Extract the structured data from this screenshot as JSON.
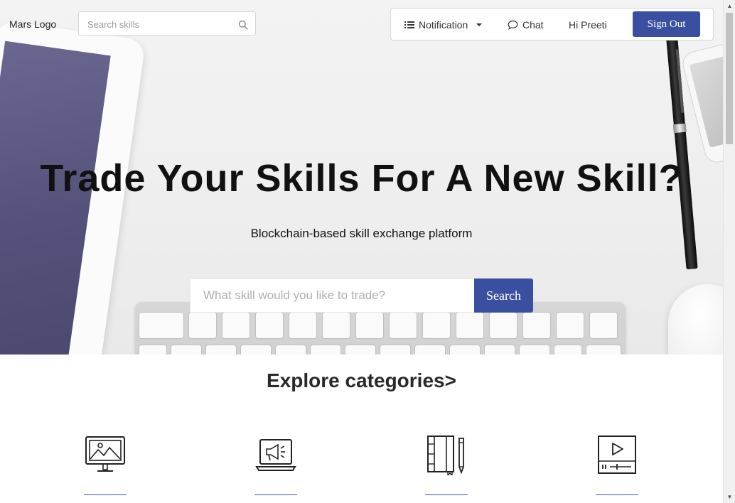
{
  "header": {
    "logo_text": "Mars Logo",
    "search_placeholder": "Search skills",
    "notification_label": "Notification",
    "chat_label": "Chat",
    "greeting": "Hi Preeti",
    "signout_label": "Sign Out"
  },
  "hero": {
    "title": "Trade Your Skills For A New Skill?",
    "subtitle": "Blockchain-based skill exchange platform",
    "search_placeholder": "What skill would you like to trade?",
    "search_button": "Search"
  },
  "categories": {
    "heading": "Explore categories>",
    "items": [
      {
        "icon": "monitor-image-icon"
      },
      {
        "icon": "laptop-megaphone-icon"
      },
      {
        "icon": "notebook-pencil-icon"
      },
      {
        "icon": "video-player-icon"
      }
    ]
  },
  "colors": {
    "accent": "#3b4fa0",
    "tablet_screen": "#54527a"
  }
}
